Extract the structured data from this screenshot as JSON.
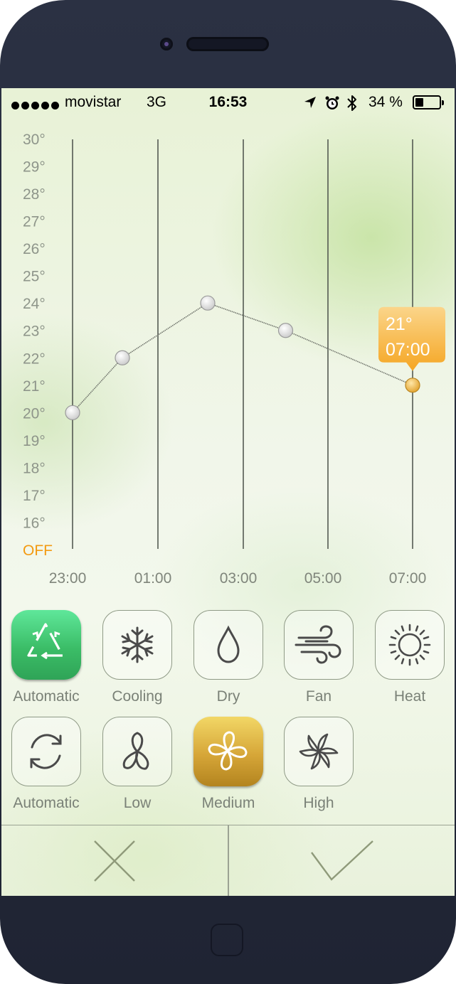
{
  "status_bar": {
    "carrier": "movistar",
    "network": "3G",
    "time": "16:53",
    "battery_percent": "34 %",
    "battery_level": 0.34,
    "icons": [
      "signal-dots-icon",
      "location-arrow-icon",
      "alarm-clock-icon",
      "bluetooth-icon",
      "battery-icon"
    ]
  },
  "chart_data": {
    "type": "line",
    "y_tick_labels": [
      "30°",
      "29°",
      "28°",
      "27°",
      "26°",
      "25°",
      "24°",
      "23°",
      "22°",
      "21°",
      "20°",
      "19°",
      "18°",
      "17°",
      "16°",
      "OFF"
    ],
    "x": [
      "23:00",
      "01:00",
      "03:00",
      "05:00",
      "07:00"
    ],
    "x_tick_labels": [
      "23:00",
      "01:00",
      "03:00",
      "05:00",
      "07:00"
    ],
    "points": [
      {
        "time": "23:00",
        "temp": 20
      },
      {
        "time": "00:10",
        "temp": 22
      },
      {
        "time": "02:10",
        "temp": 24
      },
      {
        "time": "04:00",
        "temp": 23
      },
      {
        "time": "07:00",
        "temp": 21
      }
    ],
    "ylim": [
      15,
      30
    ],
    "selected_index": 4,
    "tooltip": {
      "temp_label": "21°",
      "time_label": "07:00"
    },
    "colors": {
      "off_label": "#f39a11",
      "line": "#6f736b",
      "tooltip": "#f7b236",
      "selected_point": "#f0b23a"
    }
  },
  "modes": {
    "items": [
      {
        "label": "Automatic",
        "icon": "automatic-triangle-icon",
        "active": true
      },
      {
        "label": "Cooling",
        "icon": "snowflake-icon",
        "active": false
      },
      {
        "label": "Dry",
        "icon": "water-drop-icon",
        "active": false
      },
      {
        "label": "Fan",
        "icon": "wind-icon",
        "active": false
      },
      {
        "label": "Heat",
        "icon": "sun-icon",
        "active": false
      }
    ],
    "active_color": "#3bbd67"
  },
  "fan_speeds": {
    "items": [
      {
        "label": "Automatic",
        "icon": "refresh-icon",
        "active": false
      },
      {
        "label": "Low",
        "icon": "fan-low-icon",
        "active": false
      },
      {
        "label": "Medium",
        "icon": "fan-medium-icon",
        "active": true
      },
      {
        "label": "High",
        "icon": "fan-high-icon",
        "active": false
      }
    ],
    "active_color": "#d6a638"
  },
  "actions": {
    "cancel_icon": "close-icon",
    "confirm_icon": "checkmark-icon"
  }
}
